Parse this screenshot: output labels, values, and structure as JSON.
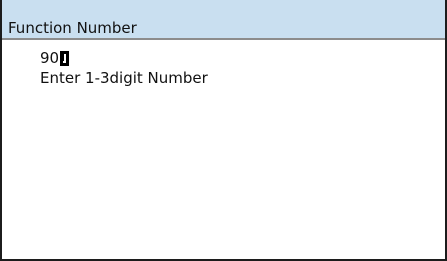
{
  "window": {
    "title": "Function Number"
  },
  "entry": {
    "value": "90",
    "cursor_icon": "enter-return-cursor-icon"
  },
  "prompt": {
    "hint": "Enter 1-3digit Number"
  },
  "colors": {
    "title_bar_background": "#c9dff0",
    "frame_border": "#1c1c1c",
    "text": "#111111",
    "background": "#ffffff"
  }
}
